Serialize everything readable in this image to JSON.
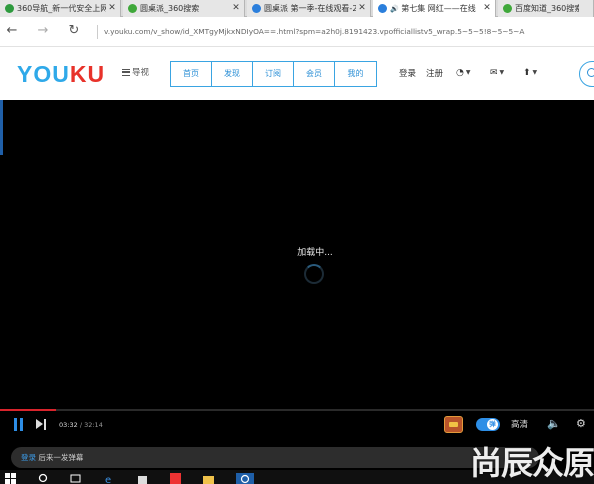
{
  "browser": {
    "tabs": [
      {
        "title": "360导航_新一代安全上网导航",
        "favicon_color": "#2e9a3e"
      },
      {
        "title": "圆桌派_360搜索",
        "favicon_color": "#3fa83a"
      },
      {
        "title": "圆桌派 第一季-在线观看-2",
        "favicon_color": "#2b7fdc"
      },
      {
        "title": "第七集 网红——在线",
        "favicon_color": "#2b7fdc",
        "audio": "🔊"
      },
      {
        "title": "百度知道_360搜索",
        "favicon_color": "#3fa83a"
      }
    ],
    "close_glyph": "✕",
    "back_glyph": "←",
    "forward_glyph": "→",
    "reload_glyph": "↻",
    "url": "v.youku.com/v_show/id_XMTgyMjkxNDIyOA==.html?spm=a2h0j.8191423.vpofficiallistv5_wrap.5~5~5!8~5~5~A"
  },
  "header": {
    "logo_part1": "YOU",
    "logo_part2": "KU",
    "menu_label": "导视",
    "nav_tabs": [
      "首页",
      "发现",
      "订阅",
      "会员",
      "我的"
    ],
    "login": "登录",
    "register": "注册",
    "history_icon": "◔",
    "message_icon": "✉",
    "upload_icon": "⬆",
    "caret": "▼",
    "accent_color": "#2b8fd6"
  },
  "player": {
    "loading_text": "加载中...",
    "progress_fraction": 0.095,
    "current_time": "03:32",
    "time_separator": "/",
    "duration": "32:14",
    "danmu_toggle_label": "弹",
    "quality": "高清",
    "volume_icon": "🔈",
    "settings_icon": "⚙",
    "danmu_login": "登录",
    "danmu_prompt": "后来一发弹幕",
    "accent_color": "#2d8ee6",
    "progress_color": "#d8242c"
  },
  "watermark": "尚辰众原"
}
